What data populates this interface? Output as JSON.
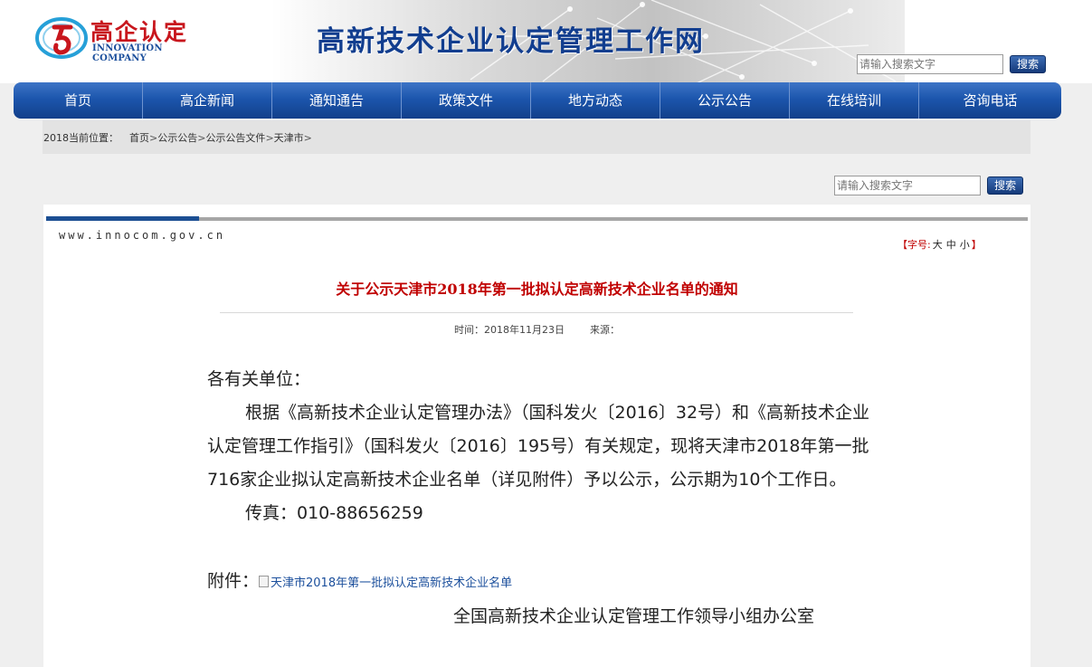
{
  "header": {
    "logo_cn": "高企认定",
    "logo_en": "INNOVATION COMPANY",
    "site_title": "高新技术企业认定管理工作网",
    "search": {
      "placeholder": "请输入搜索文字",
      "button": "搜索"
    },
    "colors": {
      "brand_blue": "#123e8f",
      "logo_red": "#c8161d"
    }
  },
  "nav": {
    "items": [
      {
        "label": "首页"
      },
      {
        "label": "高企新闻"
      },
      {
        "label": "通知通告"
      },
      {
        "label": "政策文件"
      },
      {
        "label": "地方动态"
      },
      {
        "label": "公示公告"
      },
      {
        "label": "在线培训"
      },
      {
        "label": "咨询电话"
      }
    ]
  },
  "breadcrumb": {
    "lead": "2018当前位置：",
    "items": [
      "首页",
      "公示公告",
      "公示公告文件",
      "天津市"
    ],
    "separator": ">"
  },
  "content_search": {
    "placeholder": "请输入搜索文字",
    "button": "搜索"
  },
  "article": {
    "domain": "www.innocom.gov.cn",
    "font_size": {
      "open": "【字号:",
      "options": [
        "大",
        "中",
        "小"
      ],
      "close": "】"
    },
    "title": "关于公示天津市2018年第一批拟认定高新技术企业名单的通知",
    "meta": {
      "time": "时间：2018年11月23日",
      "source": "来源："
    },
    "salutation": "各有关单位：",
    "paragraph": "根据《高新技术企业认定管理办法》（国科发火〔2016〕32号）和《高新技术企业认定管理工作指引》（国科发火〔2016〕195号）有关规定，现将天津市2018年第一批716家企业拟认定高新技术企业名单（详见附件）予以公示，公示期为10个工作日。",
    "fax": "传真：010-88656259",
    "attachment_label": "附件：",
    "attachment_link": "天津市2018年第一批拟认定高新技术企业名单",
    "signature": "全国高新技术企业认定管理工作领导小组办公室"
  }
}
